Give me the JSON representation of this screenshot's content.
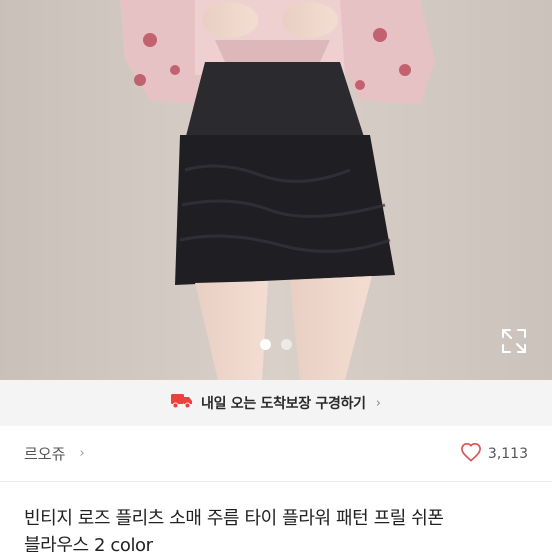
{
  "product": {
    "image_alt_icon": "product-photo",
    "carousel": {
      "total": 2,
      "current": 1
    },
    "expand_icon": "expand-icon"
  },
  "delivery_banner": {
    "icon": "truck-icon",
    "text": "내일 오는 도착보장 구경하기",
    "accent_color": "#e8433c"
  },
  "seller": {
    "name": "르오쥬",
    "like_count": "3,113",
    "heart_color": "#d94f4f"
  },
  "title": {
    "line1": "빈티지 로즈 플리츠 소매 주름 타이 플라워 패턴 프릴 쉬폰",
    "line2": "블라우스 2 color"
  }
}
